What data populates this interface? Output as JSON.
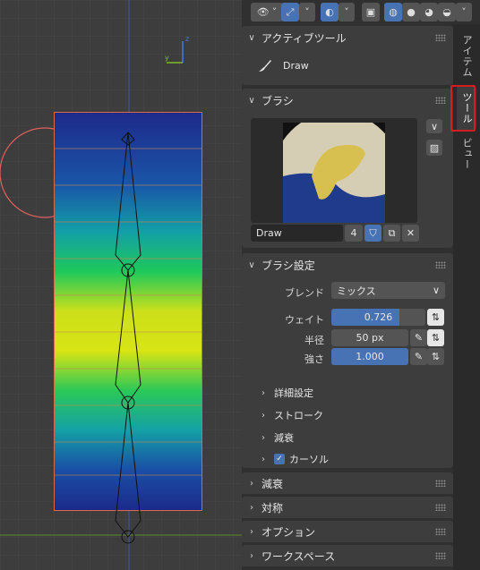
{
  "header": {
    "overlay_dropdown": "˅",
    "gizmo_dropdown": "˅",
    "shading_dropdown": "˅"
  },
  "tabs": {
    "item": "アイテム",
    "tool": "ツール",
    "view": "ビュー"
  },
  "active_tool": {
    "title": "アクティブツール",
    "tool_name": "Draw"
  },
  "brush": {
    "title": "ブラシ",
    "name": "Draw",
    "users": "4"
  },
  "brush_settings": {
    "title": "ブラシ設定",
    "blend_label": "ブレンド",
    "blend_value": "ミックス",
    "weight_label": "ウェイト",
    "weight_value": "0.726",
    "weight_fraction": 0.726,
    "radius_label": "半径",
    "radius_value": "50 px",
    "strength_label": "強さ",
    "strength_value": "1.000",
    "strength_fraction": 1.0,
    "advanced": "詳細設定",
    "stroke": "ストローク",
    "falloff": "減衰",
    "cursor": "カーソル"
  },
  "collapsed_sections": {
    "falloff": "減衰",
    "symmetry": "対称",
    "options": "オプション",
    "workspace": "ワークスペース"
  },
  "colors": {
    "accent": "#4772b3",
    "highlight": "#d21e1e"
  }
}
